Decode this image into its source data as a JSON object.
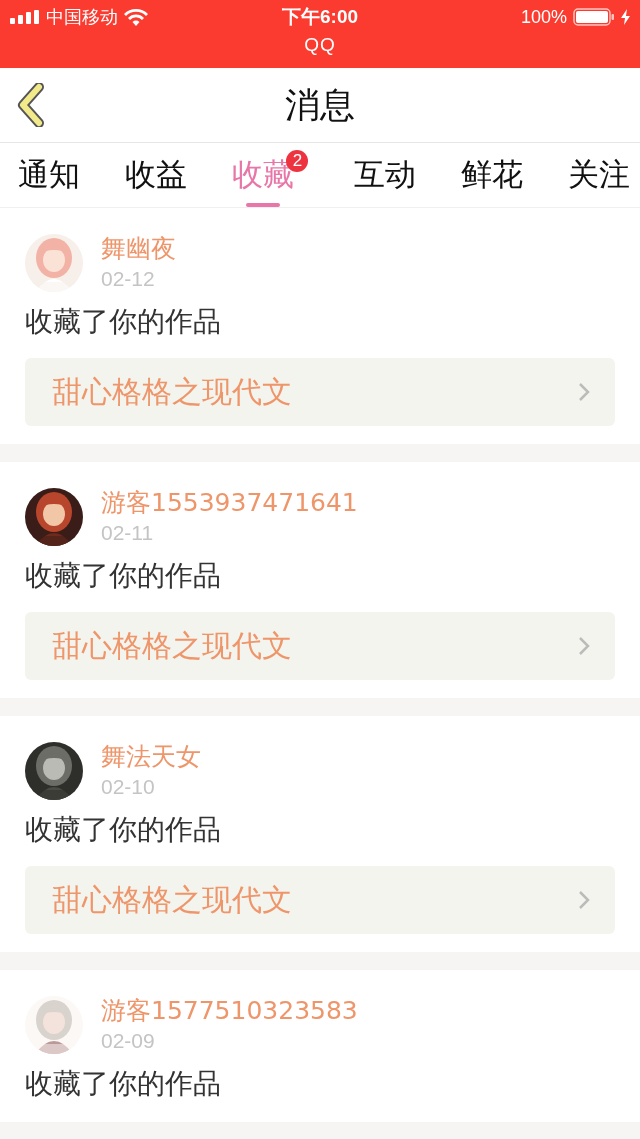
{
  "status_bar": {
    "carrier": "中国移动",
    "time": "下午6:00",
    "battery": "100%",
    "app": "QQ"
  },
  "header": {
    "title": "消息"
  },
  "tabs": [
    {
      "label": "通知",
      "selected": false
    },
    {
      "label": "收益",
      "selected": false
    },
    {
      "label": "收藏",
      "selected": true,
      "badge": "2"
    },
    {
      "label": "互动",
      "selected": false
    },
    {
      "label": "鲜花",
      "selected": false
    },
    {
      "label": "关注",
      "selected": false
    }
  ],
  "messages": [
    {
      "user": "舞幽夜",
      "date": "02-12",
      "action": "收藏了你的作品",
      "work": "甜心格格之现代文"
    },
    {
      "user": "游客1553937471641",
      "date": "02-11",
      "action": "收藏了你的作品",
      "work": "甜心格格之现代文"
    },
    {
      "user": "舞法天女",
      "date": "02-10",
      "action": "收藏了你的作品",
      "work": "甜心格格之现代文"
    },
    {
      "user": "游客1577510323583",
      "date": "02-09",
      "action": "收藏了你的作品"
    }
  ]
}
